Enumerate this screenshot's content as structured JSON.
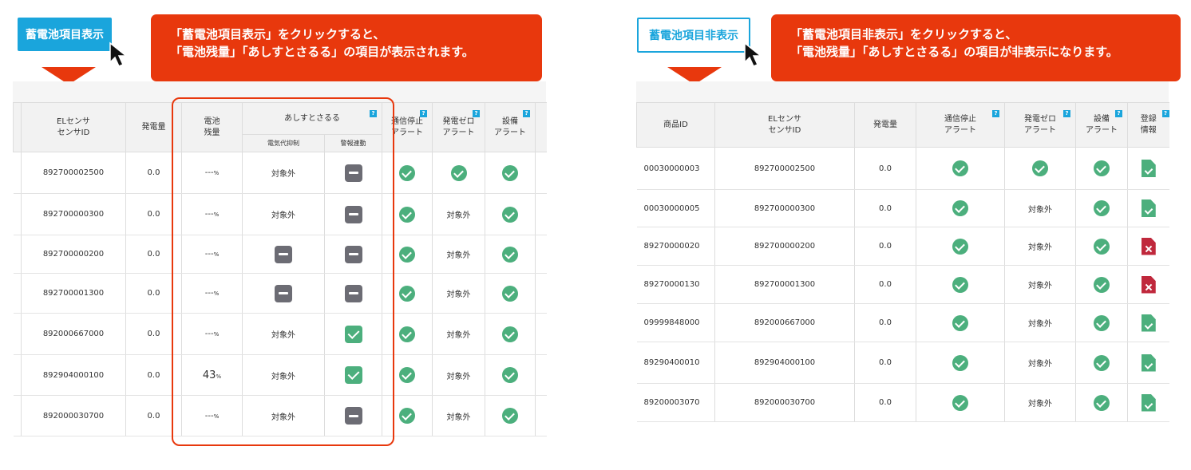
{
  "left": {
    "button_label": "蓄電池項目表示",
    "callout_line1": "「蓄電池項目表示」をクリックすると、",
    "callout_line2": "「電池残量」「あしすとさるる」の項目が表示されます。",
    "headers": {
      "sensor_line1": "ELセンサ",
      "sensor_line2": "センサID",
      "power": "発電量",
      "battery_line1": "電池",
      "battery_line2": "残量",
      "assist": "あしすとさるる",
      "sub_suppress": "電気代抑制",
      "sub_alarm": "警報連動",
      "comm_line1": "通信停止",
      "comm_line2": "アラート",
      "zero_line1": "発電ゼロ",
      "zero_line2": "アラート",
      "equip_line1": "設備",
      "equip_line2": "アラート"
    },
    "rows": [
      {
        "sensor": "892700002500",
        "power": "0.0",
        "battery": "---",
        "suppress": "対象外",
        "alarm": "minus",
        "comm": "ok",
        "zero": "ok",
        "equip": "ok"
      },
      {
        "sensor": "892700000300",
        "power": "0.0",
        "battery": "---",
        "suppress": "対象外",
        "alarm": "minus",
        "comm": "ok",
        "zero": "対象外",
        "equip": "ok"
      },
      {
        "sensor": "892700000200",
        "power": "0.0",
        "battery": "---",
        "suppress": "minus",
        "alarm": "minus",
        "comm": "ok",
        "zero": "対象外",
        "equip": "ok"
      },
      {
        "sensor": "892700001300",
        "power": "0.0",
        "battery": "---",
        "suppress": "minus",
        "alarm": "minus",
        "comm": "ok",
        "zero": "対象外",
        "equip": "ok"
      },
      {
        "sensor": "892000667000",
        "power": "0.0",
        "battery": "---",
        "suppress": "対象外",
        "alarm": "check",
        "comm": "ok",
        "zero": "対象外",
        "equip": "ok"
      },
      {
        "sensor": "892904000100",
        "power": "0.0",
        "battery": "43",
        "suppress": "対象外",
        "alarm": "check",
        "comm": "ok",
        "zero": "対象外",
        "equip": "ok"
      },
      {
        "sensor": "892000030700",
        "power": "0.0",
        "battery": "---",
        "suppress": "対象外",
        "alarm": "minus",
        "comm": "ok",
        "zero": "対象外",
        "equip": "ok"
      }
    ],
    "percent_unit": "%"
  },
  "right": {
    "button_label": "蓄電池項目非表示",
    "callout_line1": "「蓄電池項目非表示」をクリックすると、",
    "callout_line2": "「電池残量」「あしすとさるる」の項目が非表示になります。",
    "headers": {
      "product": "商品ID",
      "sensor_line1": "ELセンサ",
      "sensor_line2": "センサID",
      "power": "発電量",
      "comm_line1": "通信停止",
      "comm_line2": "アラート",
      "zero_line1": "発電ゼロ",
      "zero_line2": "アラート",
      "equip_line1": "設備",
      "equip_line2": "アラート",
      "reg_line1": "登録",
      "reg_line2": "情報"
    },
    "rows": [
      {
        "product": "00030000003",
        "sensor": "892700002500",
        "power": "0.0",
        "comm": "ok",
        "zero": "ok",
        "equip": "ok",
        "reg": "good"
      },
      {
        "product": "00030000005",
        "sensor": "892700000300",
        "power": "0.0",
        "comm": "ok",
        "zero": "対象外",
        "equip": "ok",
        "reg": "good"
      },
      {
        "product": "89270000020",
        "sensor": "892700000200",
        "power": "0.0",
        "comm": "ok",
        "zero": "対象外",
        "equip": "ok",
        "reg": "bad"
      },
      {
        "product": "89270000130",
        "sensor": "892700001300",
        "power": "0.0",
        "comm": "ok",
        "zero": "対象外",
        "equip": "ok",
        "reg": "bad"
      },
      {
        "product": "09999848000",
        "sensor": "892000667000",
        "power": "0.0",
        "comm": "ok",
        "zero": "対象外",
        "equip": "ok",
        "reg": "good"
      },
      {
        "product": "89290400010",
        "sensor": "892904000100",
        "power": "0.0",
        "comm": "ok",
        "zero": "対象外",
        "equip": "ok",
        "reg": "good"
      },
      {
        "product": "89200003070",
        "sensor": "892000030700",
        "power": "0.0",
        "comm": "ok",
        "zero": "対象外",
        "equip": "ok",
        "reg": "good"
      }
    ]
  },
  "help_badge": "?",
  "colors": {
    "accent": "#1aa5dc",
    "callout": "#e8380d",
    "ok": "#4caf7d",
    "ng": "#c0283c",
    "minus": "#6c6c74"
  }
}
